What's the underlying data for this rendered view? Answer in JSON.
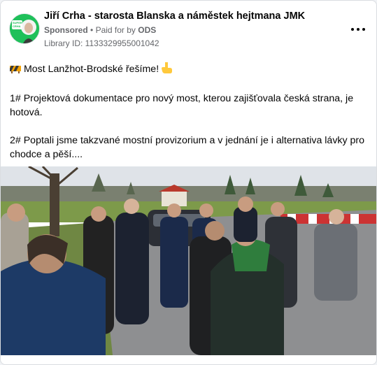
{
  "post": {
    "page_name": "Jiří Crha - starosta Blanska a náměstek hejtmana JMK",
    "sponsored": "Sponsored",
    "separator": "•",
    "paid_prefix": "Paid for by",
    "paid_by": "ODS",
    "library_id": "Library ID: 1133329955001042",
    "avatar_text": "SUPER CRHA",
    "line1": "Most Lanžhot-Brodské řešíme!",
    "line2": "1# Projektová dokumentace pro nový most, kterou zajišťovala česká strana, je hotová.",
    "line3": "2# Poptali jsme takzvané mostní provizorium a v jednání je i alternativa lávky pro chodce a pěší...."
  },
  "colors": {
    "accent": "#1fc05a",
    "meta": "#65676b",
    "text": "#050505"
  },
  "icons": {
    "construction": "construction-icon",
    "pointing": "pointing-down-icon",
    "more": "more-options-icon"
  }
}
